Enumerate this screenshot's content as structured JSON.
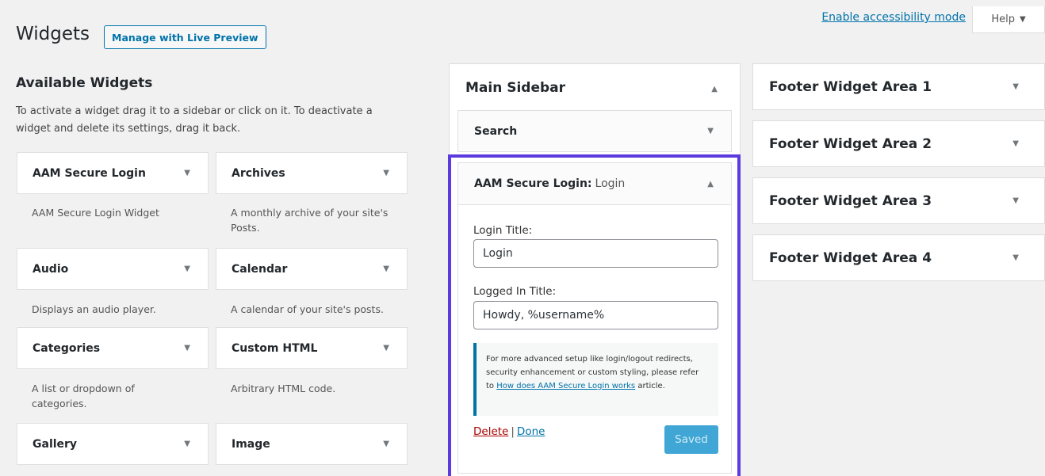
{
  "header": {
    "accessibility_link": "Enable accessibility mode",
    "help_label": "Help",
    "page_title": "Widgets",
    "live_preview_button": "Manage with Live Preview"
  },
  "available": {
    "title": "Available Widgets",
    "description": "To activate a widget drag it to a sidebar or click on it. To deactivate a widget and delete its settings, drag it back.",
    "widgets": [
      {
        "name": "AAM Secure Login",
        "desc": "AAM Secure Login Widget"
      },
      {
        "name": "Archives",
        "desc": "A monthly archive of your site's Posts."
      },
      {
        "name": "Audio",
        "desc": "Displays an audio player."
      },
      {
        "name": "Calendar",
        "desc": "A calendar of your site's posts."
      },
      {
        "name": "Categories",
        "desc": "A list or dropdown of categories."
      },
      {
        "name": "Custom HTML",
        "desc": "Arbitrary HTML code."
      },
      {
        "name": "Gallery",
        "desc": ""
      },
      {
        "name": "Image",
        "desc": ""
      }
    ]
  },
  "main_sidebar": {
    "title": "Main Sidebar",
    "search_widget": "Search",
    "aam_widget": {
      "title": "AAM Secure Login:",
      "subtitle": "Login",
      "login_title_label": "Login Title:",
      "login_title_value": "Login",
      "logged_in_label": "Logged In Title:",
      "logged_in_value": "Howdy, %username%",
      "notice_before": "For more advanced setup like login/logout redirects, security enhancement or custom styling, please refer to",
      "notice_link": "How does AAM Secure Login works",
      "notice_after": "article.",
      "delete_label": "Delete",
      "separator": "|",
      "done_label": "Done",
      "saved_label": "Saved"
    }
  },
  "footer_areas": [
    {
      "title": "Footer Widget Area 1"
    },
    {
      "title": "Footer Widget Area 2"
    },
    {
      "title": "Footer Widget Area 3"
    },
    {
      "title": "Footer Widget Area 4"
    }
  ],
  "icons": {
    "arrow_down": "▼",
    "arrow_up": "▲"
  },
  "colors": {
    "link": "#0073aa",
    "highlight": "#5b3ae0",
    "delete": "#aa0000",
    "saved_button": "#3fa6d6"
  }
}
